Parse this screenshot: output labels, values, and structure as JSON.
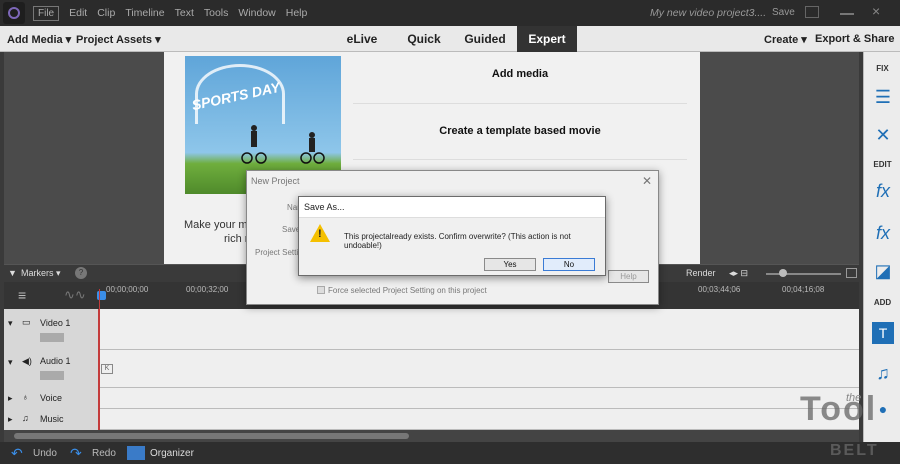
{
  "menubar": {
    "file": "File",
    "items": [
      "Edit",
      "Clip",
      "Timeline",
      "Text",
      "Tools",
      "Window",
      "Help"
    ],
    "project_name": "My new video project3....",
    "save": "Save"
  },
  "toolbar": {
    "add_media": "Add Media",
    "project_assets": "Project Assets",
    "tabs": [
      "eLive",
      "Quick",
      "Guided",
      "Expert"
    ],
    "active_tab": "Expert",
    "create": "Create",
    "export_share": "Export & Share"
  },
  "welcome": {
    "thumb_text": "SPORTS DAY",
    "make_text": "Make your mo",
    "rich_text": "rich r",
    "options": [
      "Add media",
      "Create a template based movie"
    ]
  },
  "right_panel": {
    "fix": "FIX",
    "edit": "EDIT",
    "add": "ADD"
  },
  "timeline": {
    "markers": "Markers",
    "render": "Render",
    "times": [
      "00;00;00;00",
      "00;00;32;00",
      "00;03;44;06",
      "00;04;16;08"
    ],
    "tracks": [
      "Video 1",
      "Audio 1",
      "Voice",
      "Music"
    ]
  },
  "new_project_dialog": {
    "title": "New Project",
    "name_label": "Nam",
    "save_label": "Save",
    "project_setting_label": "Project Setting",
    "help": "Help",
    "force_setting": "Force selected Project Setting on this project"
  },
  "save_as_dialog": {
    "title": "Save As...",
    "message": "This projectalready exists. Confirm overwrite? (This action is not undoable!)",
    "yes": "Yes",
    "no": "No"
  },
  "bottombar": {
    "undo": "Undo",
    "redo": "Redo",
    "organizer": "Organizer"
  },
  "watermark": {
    "line1": "Tool",
    "line2": "BELT",
    "script": "the"
  },
  "colors": {
    "playhead": "#c43b3b",
    "accent": "#1f6fb6",
    "warning": "#f5c000"
  }
}
